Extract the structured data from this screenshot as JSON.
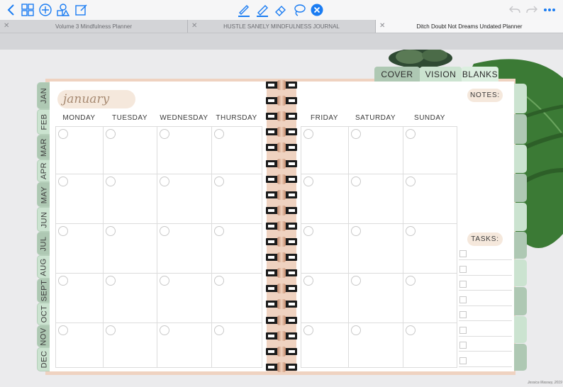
{
  "tabs": [
    {
      "label": "Volume 3 Mindfulness Planner",
      "active": false
    },
    {
      "label": "HUSTLE SANELY MINDFULNESS JOURNAL",
      "active": false
    },
    {
      "label": "Ditch Doubt Not Dreams Undated Planner",
      "active": true
    }
  ],
  "toolbar": {
    "left_icons": [
      "back-chevron-icon",
      "grid-icon",
      "add-icon",
      "shapes-icon",
      "edit-icon"
    ],
    "center_icons": [
      "pen-icon",
      "highlighter-icon",
      "eraser-icon",
      "lasso-icon",
      "close-icon"
    ],
    "right_icons": [
      "undo-icon",
      "redo-icon",
      "more-icon"
    ],
    "accent": "#1a7cf2"
  },
  "planner": {
    "top_tabs": [
      "COVER",
      "VISION",
      "BLANKS"
    ],
    "months": [
      "JAN",
      "FEB",
      "MAR",
      "APR",
      "MAY",
      "JUN",
      "JUL",
      "AUG",
      "SEPT",
      "OCT",
      "NOV",
      "DEC"
    ],
    "month_title": "january",
    "left_days": [
      "MONDAY",
      "TUESDAY",
      "WEDNESDAY",
      "THURSDAY"
    ],
    "right_days": [
      "FRIDAY",
      "SATURDAY",
      "SUNDAY"
    ],
    "notes_label": "NOTES:",
    "tasks_label": "TASKS:",
    "credit": "Jessica Massey, 2019"
  }
}
